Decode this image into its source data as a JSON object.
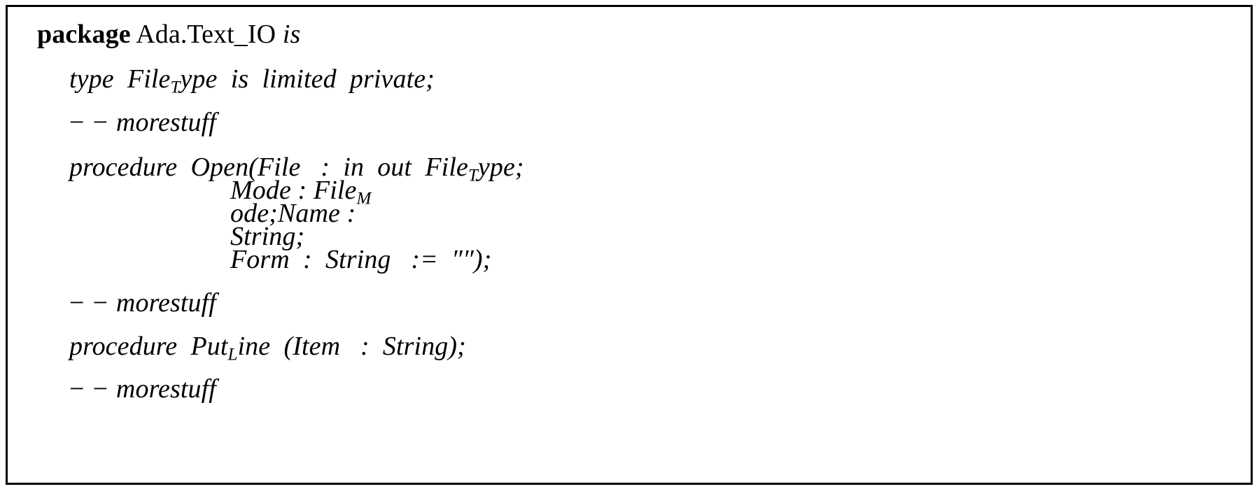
{
  "document": {
    "kind": "code-listing",
    "language": "Ada",
    "frame": {
      "border_color": "#000000",
      "background": "#ffffff",
      "border_width_px": 3
    },
    "text_color": "#000000"
  },
  "code": {
    "lines": [
      {
        "id": "package-decl",
        "tokens": [
          {
            "text": "package",
            "style": "bold-roman"
          },
          {
            "text": " ",
            "style": "space"
          },
          {
            "text": "Ada.Text_IO",
            "style": "roman"
          },
          {
            "text": " ",
            "style": "space"
          },
          {
            "text": "is",
            "style": "italic"
          }
        ],
        "plain": "package Ada.Text_IO is"
      },
      {
        "id": "type-file-type",
        "tokens": [
          {
            "text": "type",
            "style": "italic"
          },
          {
            "text": "  ",
            "style": "space"
          },
          {
            "text": "File",
            "style": "italic"
          },
          {
            "text": "T",
            "style": "subscript"
          },
          {
            "text": "ype",
            "style": "italic"
          },
          {
            "text": "  ",
            "style": "space"
          },
          {
            "text": "is",
            "style": "italic"
          },
          {
            "text": "  ",
            "style": "space"
          },
          {
            "text": "limited",
            "style": "italic"
          },
          {
            "text": "  ",
            "style": "space"
          },
          {
            "text": "private;",
            "style": "italic"
          }
        ],
        "plain": "type  File_Type  is  limited  private;"
      },
      {
        "id": "comment-1",
        "tokens": [
          {
            "text": "− −",
            "style": "minus-pair"
          },
          {
            "text": " ",
            "style": "space"
          },
          {
            "text": "morestuff",
            "style": "italic"
          }
        ],
        "plain": "-- morestuff"
      },
      {
        "id": "procedure-open",
        "tokens": [
          {
            "text": "procedure",
            "style": "italic"
          },
          {
            "text": "  ",
            "style": "space"
          },
          {
            "text": "Open(File",
            "style": "italic"
          },
          {
            "text": "   ",
            "style": "space"
          },
          {
            "text": ":",
            "style": "italic"
          },
          {
            "text": "  ",
            "style": "space"
          },
          {
            "text": "in",
            "style": "italic"
          },
          {
            "text": "  ",
            "style": "space"
          },
          {
            "text": "out",
            "style": "italic"
          },
          {
            "text": "  ",
            "style": "space"
          },
          {
            "text": "File",
            "style": "italic"
          },
          {
            "text": "T",
            "style": "subscript"
          },
          {
            "text": "ype;",
            "style": "italic"
          }
        ],
        "plain": "procedure  Open(File   :  in  out  File_Type;"
      },
      {
        "id": "param-mode",
        "tokens": [
          {
            "text": "Mode",
            "style": "italic"
          },
          {
            "text": " ",
            "style": "space"
          },
          {
            "text": ":",
            "style": "italic"
          },
          {
            "text": " ",
            "style": "space"
          },
          {
            "text": "File",
            "style": "italic"
          },
          {
            "text": "M",
            "style": "subscript"
          }
        ],
        "plain": "Mode : File_M"
      },
      {
        "id": "param-ode-name",
        "tokens": [
          {
            "text": "ode;Name",
            "style": "italic"
          },
          {
            "text": " ",
            "style": "space"
          },
          {
            "text": ":",
            "style": "italic"
          }
        ],
        "plain": "ode;Name :"
      },
      {
        "id": "param-string",
        "tokens": [
          {
            "text": "String;",
            "style": "italic"
          }
        ],
        "plain": "String;"
      },
      {
        "id": "param-form",
        "tokens": [
          {
            "text": "Form",
            "style": "italic"
          },
          {
            "text": "  ",
            "style": "space"
          },
          {
            "text": ":",
            "style": "italic"
          },
          {
            "text": "  ",
            "style": "space"
          },
          {
            "text": "String",
            "style": "italic"
          },
          {
            "text": "   ",
            "style": "space"
          },
          {
            "text": ":=",
            "style": "italic"
          },
          {
            "text": "  ",
            "style": "space"
          },
          {
            "text": "″″);",
            "style": "italic"
          }
        ],
        "plain": "Form  :  String   :=  \"\");"
      },
      {
        "id": "comment-2",
        "tokens": [
          {
            "text": "− −",
            "style": "minus-pair"
          },
          {
            "text": " ",
            "style": "space"
          },
          {
            "text": "morestuff",
            "style": "italic"
          }
        ],
        "plain": "-- morestuff"
      },
      {
        "id": "procedure-put-line",
        "tokens": [
          {
            "text": "procedure",
            "style": "italic"
          },
          {
            "text": "  ",
            "style": "space"
          },
          {
            "text": "Put",
            "style": "italic"
          },
          {
            "text": "L",
            "style": "subscript"
          },
          {
            "text": "ine",
            "style": "italic"
          },
          {
            "text": "  ",
            "style": "space"
          },
          {
            "text": "(Item",
            "style": "italic"
          },
          {
            "text": "   ",
            "style": "space"
          },
          {
            "text": ":",
            "style": "italic"
          },
          {
            "text": "  ",
            "style": "space"
          },
          {
            "text": "String);",
            "style": "italic"
          }
        ],
        "plain": "procedure  Put_Line  (Item   :  String);"
      },
      {
        "id": "comment-3",
        "tokens": [
          {
            "text": "− −",
            "style": "minus-pair"
          },
          {
            "text": " ",
            "style": "space"
          },
          {
            "text": "morestuff",
            "style": "italic"
          }
        ],
        "plain": "-- morestuff"
      }
    ],
    "line_text": {
      "package_keyword": "package",
      "package_name": "Ada.Text_IO",
      "package_is": "is",
      "type_keyword": "type",
      "type_name_head": "File",
      "type_name_sub": "T",
      "type_name_tail": "ype",
      "type_is": "is",
      "type_limited": "limited",
      "type_private": "private;",
      "comment_dashes": "− −",
      "comment_text": "morestuff",
      "open_procedure_keyword": "procedure",
      "open_name_and_first_param": "Open(File",
      "open_colon": ":",
      "open_in": "in",
      "open_out": "out",
      "open_type_head": "File",
      "open_type_sub": "T",
      "open_type_tail": "ype;",
      "mode_param": "Mode",
      "mode_colon": ":",
      "mode_type_head": "File",
      "mode_type_sub": "M",
      "ode_name": "ode;Name",
      "ode_name_colon": ":",
      "string_param": "String;",
      "form_param": "Form",
      "form_colon": ":",
      "form_type": "String",
      "form_assign": ":=",
      "form_default": "″″);",
      "putline_procedure_keyword": "procedure",
      "putline_head": "Put",
      "putline_sub": "L",
      "putline_tail": "ine",
      "putline_open_paren_item": "(Item",
      "putline_colon": ":",
      "putline_type": "String);"
    }
  }
}
